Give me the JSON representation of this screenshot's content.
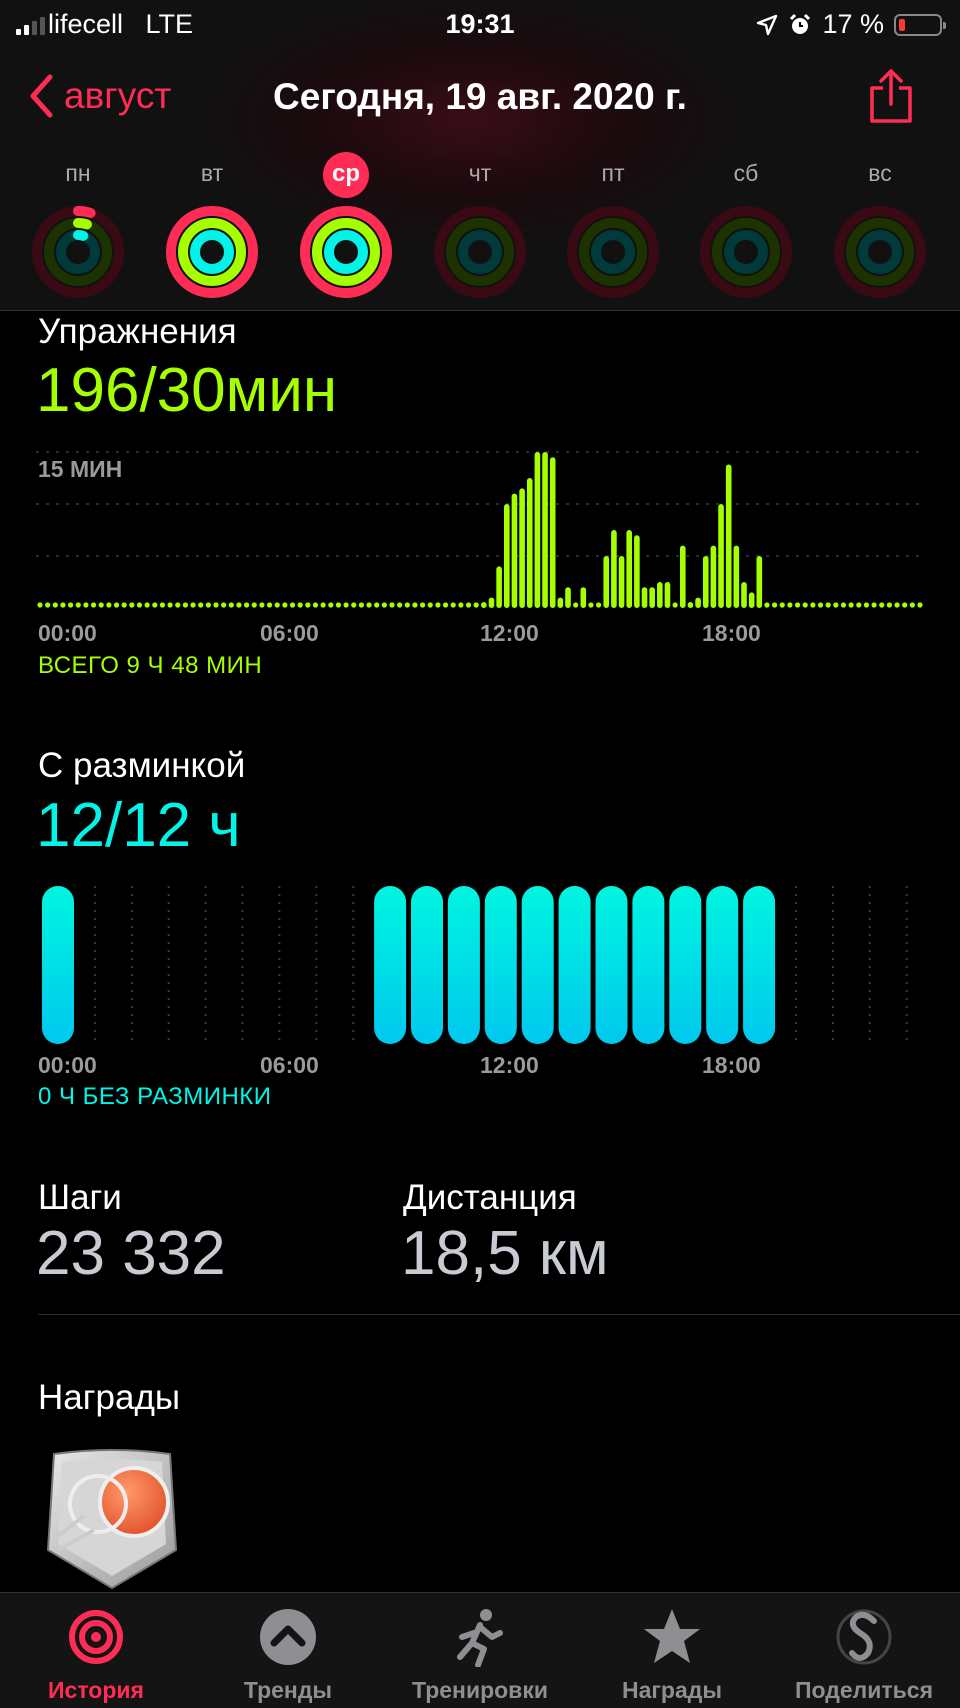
{
  "status_bar": {
    "carrier": "lifecell",
    "network": "LTE",
    "time": "19:31",
    "battery": "17 %",
    "battery_level": 0.17
  },
  "nav": {
    "back_label": "август",
    "title": "Сегодня, 19 авг. 2020 г."
  },
  "week": [
    {
      "label": "пн",
      "selected": false,
      "move": 0.05,
      "exercise": 0.05,
      "stand": 0.05
    },
    {
      "label": "вт",
      "selected": false,
      "move": 1,
      "exercise": 1,
      "stand": 1
    },
    {
      "label": "ср",
      "selected": true,
      "move": 1,
      "exercise": 1,
      "stand": 1
    },
    {
      "label": "чт",
      "selected": false,
      "move": 0,
      "exercise": 0,
      "stand": 0
    },
    {
      "label": "пт",
      "selected": false,
      "move": 0,
      "exercise": 0,
      "stand": 0
    },
    {
      "label": "сб",
      "selected": false,
      "move": 0,
      "exercise": 0,
      "stand": 0
    },
    {
      "label": "вс",
      "selected": false,
      "move": 0,
      "exercise": 0,
      "stand": 0
    }
  ],
  "colors": {
    "accent": "#ff2d55",
    "exercise": "#a6ff00",
    "stand": "#00f5e8"
  },
  "exercise": {
    "title": "Упражнения",
    "value": "196/30мин",
    "gridline_label": "15 МИН",
    "axis": [
      "00:00",
      "06:00",
      "12:00",
      "18:00"
    ],
    "total": "ВСЕГО 9 Ч 48 МИН"
  },
  "stand": {
    "title": "С разминкой",
    "value": "12/12 ч",
    "axis": [
      "00:00",
      "06:00",
      "12:00",
      "18:00"
    ],
    "note": "0 Ч БЕЗ РАЗМИНКИ"
  },
  "steps": {
    "label": "Шаги",
    "value": "23 332"
  },
  "distance": {
    "label": "Дистанция",
    "value": "18,5 км"
  },
  "awards": {
    "title": "Награды"
  },
  "tabs": [
    {
      "label": "История",
      "icon": "history-rings-icon",
      "active": true
    },
    {
      "label": "Тренды",
      "icon": "trends-chevron-icon",
      "active": false
    },
    {
      "label": "Тренировки",
      "icon": "runner-icon",
      "active": false
    },
    {
      "label": "Награды",
      "icon": "award-star-icon",
      "active": false
    },
    {
      "label": "Поделиться",
      "icon": "share-s-icon",
      "active": false
    }
  ],
  "chart_data": [
    {
      "type": "bar",
      "title": "Упражнения",
      "unit": "мин",
      "x_range": [
        "00:00",
        "24:00"
      ],
      "gridline": 15,
      "ylim": [
        0,
        15
      ],
      "values": [
        0,
        0,
        0,
        0,
        0,
        0,
        0,
        0,
        0,
        0,
        0,
        0,
        0,
        0,
        0,
        0,
        0,
        0,
        0,
        0,
        0,
        0,
        0,
        0,
        0,
        0,
        0,
        0,
        0,
        0,
        0,
        0,
        0,
        0,
        0,
        0,
        0,
        0,
        0,
        0,
        0,
        0,
        0,
        0,
        0,
        0,
        0,
        0,
        0,
        0,
        0,
        0,
        0,
        0,
        0,
        0,
        0,
        0,
        0.5,
        1,
        4,
        10,
        11,
        11.5,
        12.5,
        15,
        15,
        14.5,
        1,
        2,
        0,
        2,
        0,
        0,
        5,
        7.5,
        5,
        7.5,
        7,
        2,
        2,
        2.5,
        2.5,
        0,
        6,
        0.5,
        1,
        5,
        6,
        10,
        13.8,
        6,
        2.5,
        1.5,
        5,
        0,
        0,
        0,
        0,
        0,
        0,
        0,
        0,
        0,
        0,
        0,
        0,
        0,
        0,
        0,
        0,
        0,
        0,
        0,
        0,
        0
      ]
    },
    {
      "type": "bar",
      "title": "С разминкой",
      "unit": "ч",
      "hours_stood": [
        0,
        9,
        10,
        11,
        12,
        13,
        14,
        15,
        16,
        17,
        18,
        19
      ]
    }
  ]
}
